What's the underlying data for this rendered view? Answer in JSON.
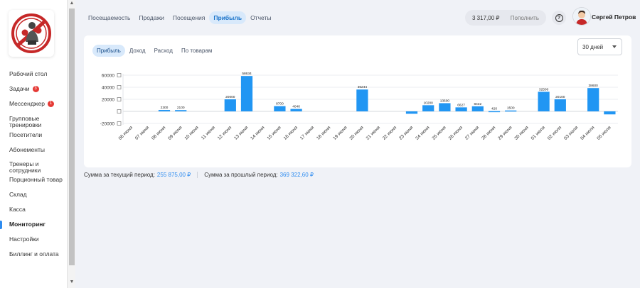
{
  "sidebar": {
    "items": [
      {
        "label": "Рабочий стол",
        "badge": "",
        "active": false
      },
      {
        "label": "Задачи",
        "badge": "3",
        "active": false
      },
      {
        "label": "Мессенджер",
        "badge": "1",
        "active": false
      },
      {
        "label": "Групповые\nтренировки",
        "badge": "",
        "active": false
      },
      {
        "label": "Посетители",
        "badge": "",
        "active": false
      },
      {
        "label": "Абонементы",
        "badge": "",
        "active": false
      },
      {
        "label": "Тренеры и\nсотрудники",
        "badge": "",
        "active": false
      },
      {
        "label": "Порционный товар",
        "badge": "",
        "active": false
      },
      {
        "label": "Склад",
        "badge": "",
        "active": false
      },
      {
        "label": "Касса",
        "badge": "",
        "active": false
      },
      {
        "label": "Мониторинг",
        "badge": "",
        "active": true
      },
      {
        "label": "Настройки",
        "badge": "",
        "active": false
      },
      {
        "label": "Биллинг и оплата",
        "badge": "",
        "active": false
      }
    ]
  },
  "header": {
    "tabs": [
      {
        "label": "Посещаемость",
        "active": false
      },
      {
        "label": "Продажи",
        "active": false
      },
      {
        "label": "Посещения",
        "active": false
      },
      {
        "label": "Прибыль",
        "active": true
      },
      {
        "label": "Отчеты",
        "active": false
      }
    ],
    "balance": "3 317,00 ₽",
    "topup_label": "Пополнить",
    "help_glyph": "?",
    "user_name": "Сергей Петров"
  },
  "card": {
    "subtabs": [
      {
        "label": "Прибыль",
        "active": true
      },
      {
        "label": "Доход",
        "active": false
      },
      {
        "label": "Расход",
        "active": false
      },
      {
        "label": "По товарам",
        "active": false
      }
    ],
    "period": "30 дней"
  },
  "summary": {
    "current_label": "Сумма за текущий период:",
    "current_value": "255 875,00 ₽",
    "previous_label": "Сумма за прошлый период:",
    "previous_value": "369 322,60 ₽"
  },
  "colors": {
    "accent": "#2e8cf0",
    "bar": "#2196f3",
    "badge": "#e53935"
  },
  "chart_data": {
    "type": "bar",
    "categories": [
      "06 июня",
      "07 июня",
      "08 июня",
      "09 июня",
      "10 июня",
      "11 июня",
      "12 июня",
      "13 июня",
      "14 июня",
      "15 июня",
      "16 июня",
      "17 июня",
      "18 июня",
      "19 июня",
      "20 июня",
      "21 июня",
      "22 июня",
      "23 июня",
      "24 июня",
      "25 июня",
      "26 июня",
      "27 июня",
      "28 июня",
      "29 июня",
      "30 июня",
      "01 июля",
      "02 июля",
      "03 июля",
      "04 июля",
      "05 июля"
    ],
    "values": [
      0,
      0,
      2300,
      2100,
      0,
      0,
      20000,
      58634,
      0,
      8700,
      4040,
      0,
      0,
      0,
      36244,
      0,
      0,
      -4000,
      10200,
      13600,
      6627,
      8432,
      420,
      1500,
      0,
      32500,
      20100,
      0,
      38600,
      -5000
    ],
    "data_labels": [
      "",
      "",
      "2300",
      "2100",
      "",
      "",
      "20000",
      "58634",
      "",
      "8700",
      "4040",
      "",
      "",
      "",
      "36244",
      "",
      "",
      "",
      "10200",
      "13600",
      "6627",
      "8432",
      "420",
      "1500",
      "",
      "32500",
      "20100",
      "",
      "38600",
      ""
    ],
    "y_ticks": [
      "60000",
      "40000",
      "20000",
      "",
      "-20000"
    ],
    "ylim": [
      -20000,
      60000
    ],
    "grid": true
  }
}
